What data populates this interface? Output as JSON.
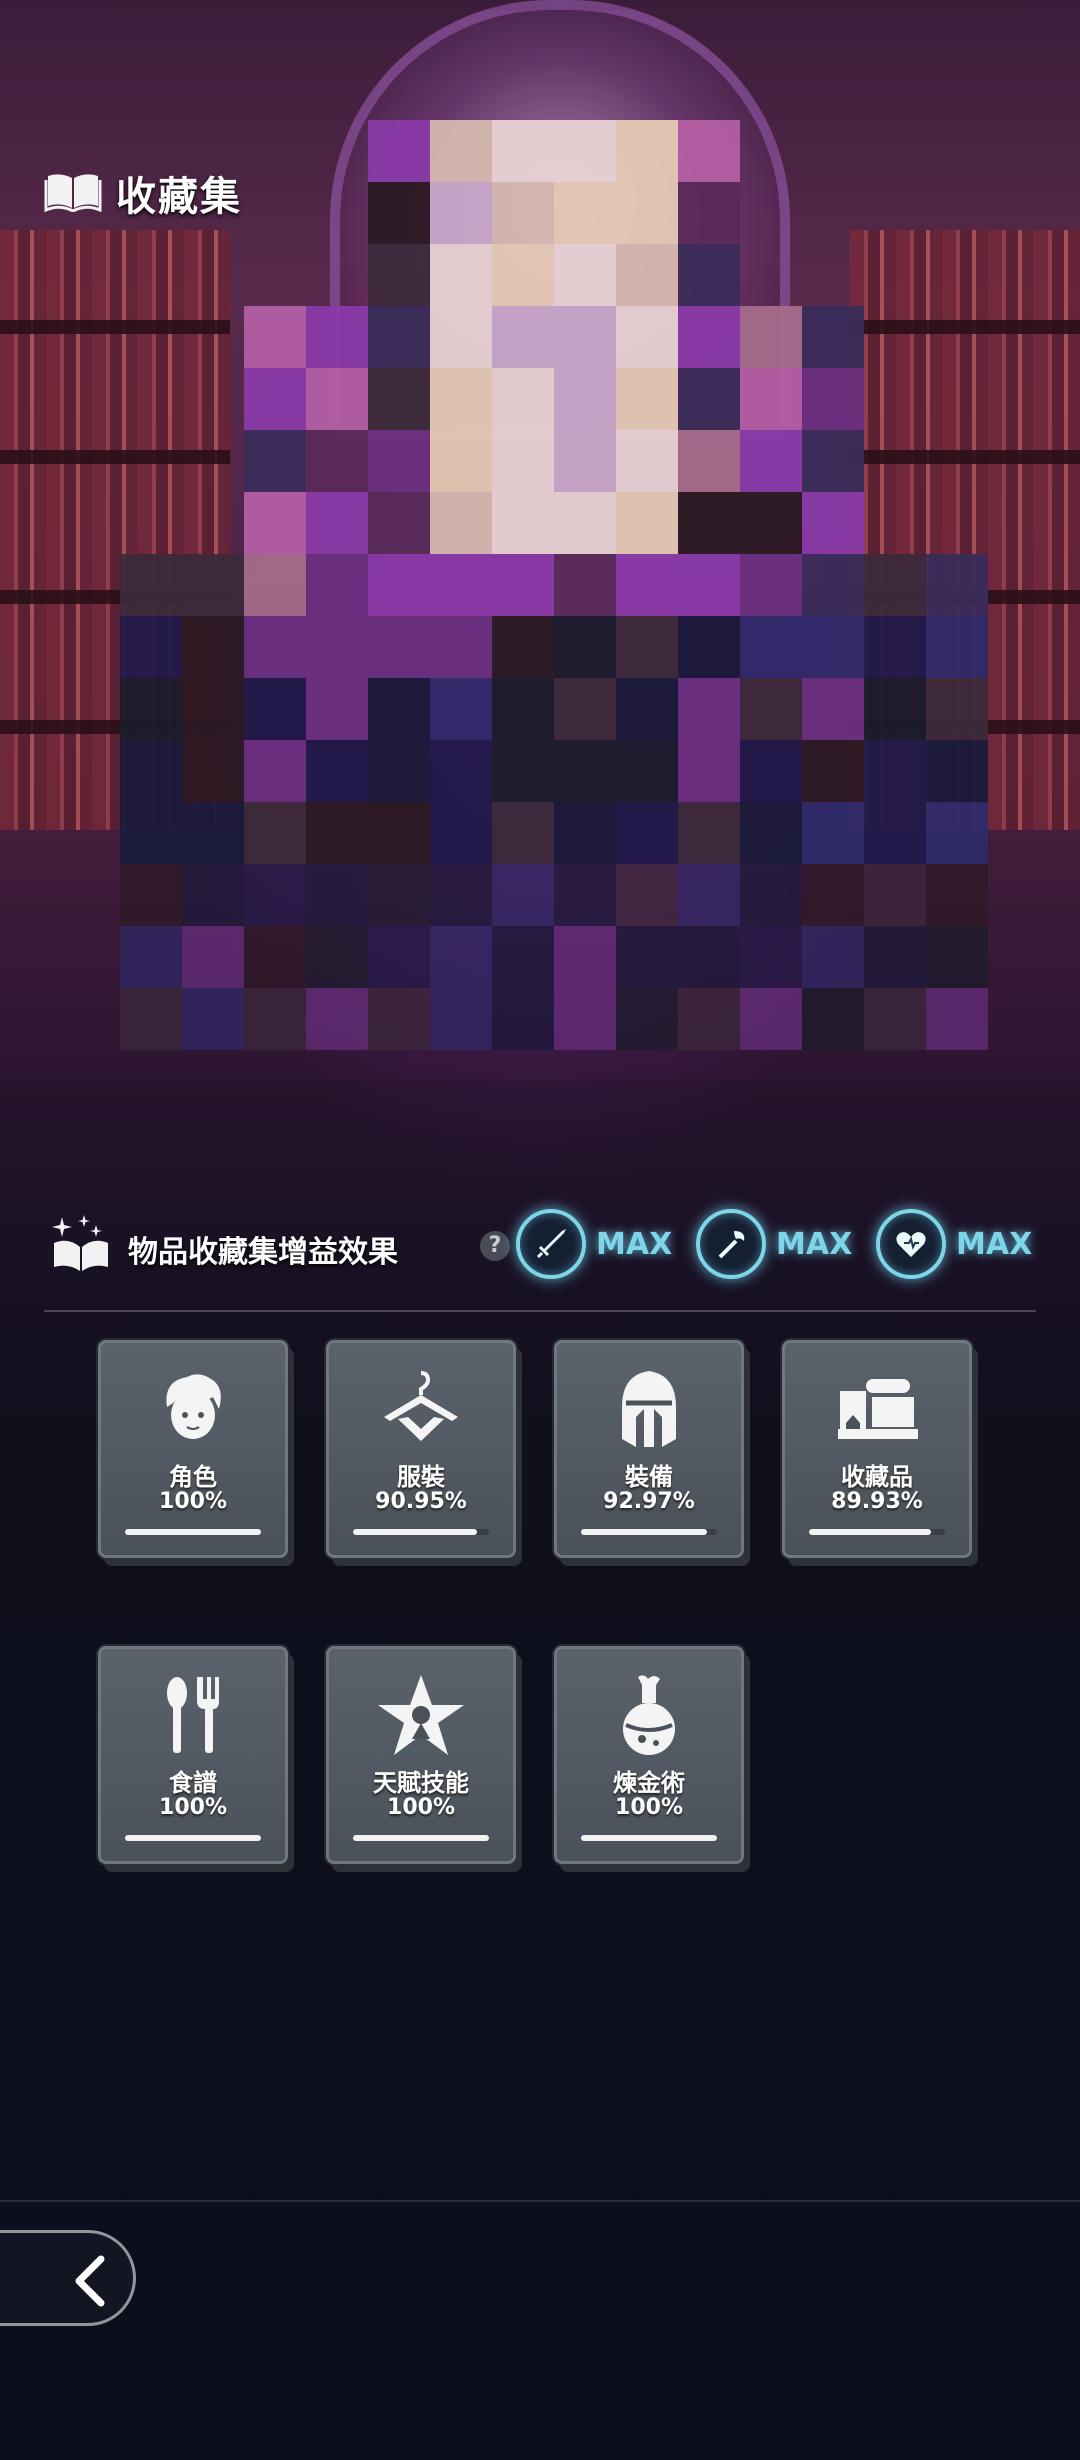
{
  "header": {
    "title": "收藏集",
    "icon": "book-icon"
  },
  "buffs": {
    "label": "物品收藏集增益效果",
    "help_icon_text": "?",
    "items": [
      {
        "icon": "sword-icon",
        "value": "MAX"
      },
      {
        "icon": "wand-icon",
        "value": "MAX"
      },
      {
        "icon": "heart-icon",
        "value": "MAX"
      }
    ]
  },
  "categories": [
    {
      "name": "角色",
      "percent": "100%",
      "progress": 1.0,
      "icon": "character-face-icon"
    },
    {
      "name": "服裝",
      "percent": "90.95%",
      "progress": 0.9095,
      "icon": "hanger-icon"
    },
    {
      "name": "裝備",
      "percent": "92.97%",
      "progress": 0.9297,
      "icon": "helmet-icon"
    },
    {
      "name": "收藏品",
      "percent": "89.93%",
      "progress": 0.8993,
      "icon": "scroll-collectibles-icon"
    },
    {
      "name": "食譜",
      "percent": "100%",
      "progress": 1.0,
      "icon": "spoon-fork-icon"
    },
    {
      "name": "天賦技能",
      "percent": "100%",
      "progress": 1.0,
      "icon": "star-talent-icon"
    },
    {
      "name": "煉金術",
      "percent": "100%",
      "progress": 1.0,
      "icon": "potion-icon"
    }
  ],
  "colors": {
    "accent_cyan": "#7fd5e8",
    "card_bg": "#525a63"
  }
}
